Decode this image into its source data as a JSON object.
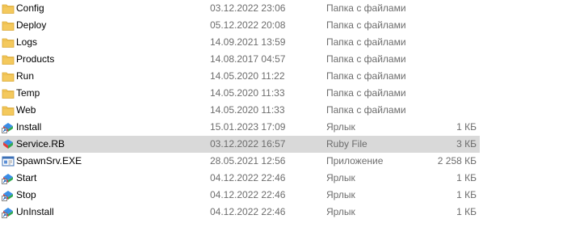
{
  "files": [
    {
      "name": "Config",
      "date": "03.12.2022 23:06",
      "type": "Папка с файлами",
      "size": "",
      "icon": "folder-icon",
      "selected": false
    },
    {
      "name": "Deploy",
      "date": "05.12.2022 20:08",
      "type": "Папка с файлами",
      "size": "",
      "icon": "folder-icon",
      "selected": false
    },
    {
      "name": "Logs",
      "date": "14.09.2021 13:59",
      "type": "Папка с файлами",
      "size": "",
      "icon": "folder-icon",
      "selected": false
    },
    {
      "name": "Products",
      "date": "14.08.2017 04:57",
      "type": "Папка с файлами",
      "size": "",
      "icon": "folder-icon",
      "selected": false
    },
    {
      "name": "Run",
      "date": "14.05.2020 11:22",
      "type": "Папка с файлами",
      "size": "",
      "icon": "folder-icon",
      "selected": false
    },
    {
      "name": "Temp",
      "date": "14.05.2020 11:33",
      "type": "Папка с файлами",
      "size": "",
      "icon": "folder-icon",
      "selected": false
    },
    {
      "name": "Web",
      "date": "14.05.2020 11:33",
      "type": "Папка с файлами",
      "size": "",
      "icon": "folder-icon",
      "selected": false
    },
    {
      "name": "Install",
      "date": "15.01.2023 17:09",
      "type": "Ярлык",
      "size": "1 КБ",
      "icon": "shortcut-icon",
      "selected": false
    },
    {
      "name": "Service.RB",
      "date": "03.12.2022 16:57",
      "type": "Ruby File",
      "size": "3 КБ",
      "icon": "ruby-file-icon",
      "selected": true
    },
    {
      "name": "SpawnSrv.EXE",
      "date": "28.05.2021 12:56",
      "type": "Приложение",
      "size": "2 258 КБ",
      "icon": "application-icon",
      "selected": false
    },
    {
      "name": "Start",
      "date": "04.12.2022 22:46",
      "type": "Ярлык",
      "size": "1 КБ",
      "icon": "shortcut-icon",
      "selected": false
    },
    {
      "name": "Stop",
      "date": "04.12.2022 22:46",
      "type": "Ярлык",
      "size": "1 КБ",
      "icon": "shortcut-icon",
      "selected": false
    },
    {
      "name": "UnInstall",
      "date": "04.12.2022 22:46",
      "type": "Ярлык",
      "size": "1 КБ",
      "icon": "shortcut-icon",
      "selected": false
    }
  ],
  "colors": {
    "folder": "#f4c95d",
    "selection": "#d9d9d9",
    "secondary_text": "#6d6d6d"
  }
}
